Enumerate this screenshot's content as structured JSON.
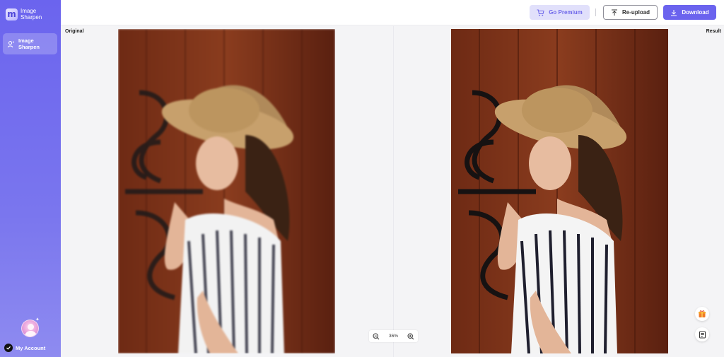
{
  "app": {
    "name": "Image Sharpen"
  },
  "sidebar": {
    "items": [
      {
        "label": "Image Sharpen",
        "icon": "sharpen-icon",
        "active": true
      }
    ],
    "account_label": "My Account"
  },
  "toolbar": {
    "premium_label": "Go Premium",
    "reupload_label": "Re-upload",
    "download_label": "Download"
  },
  "compare": {
    "left_label": "Original",
    "right_label": "Result"
  },
  "zoom": {
    "value": "36%"
  },
  "colors": {
    "accent": "#6b63ee",
    "premium_bg": "#e1e0fb",
    "sidebar_top": "#6b64ee"
  }
}
